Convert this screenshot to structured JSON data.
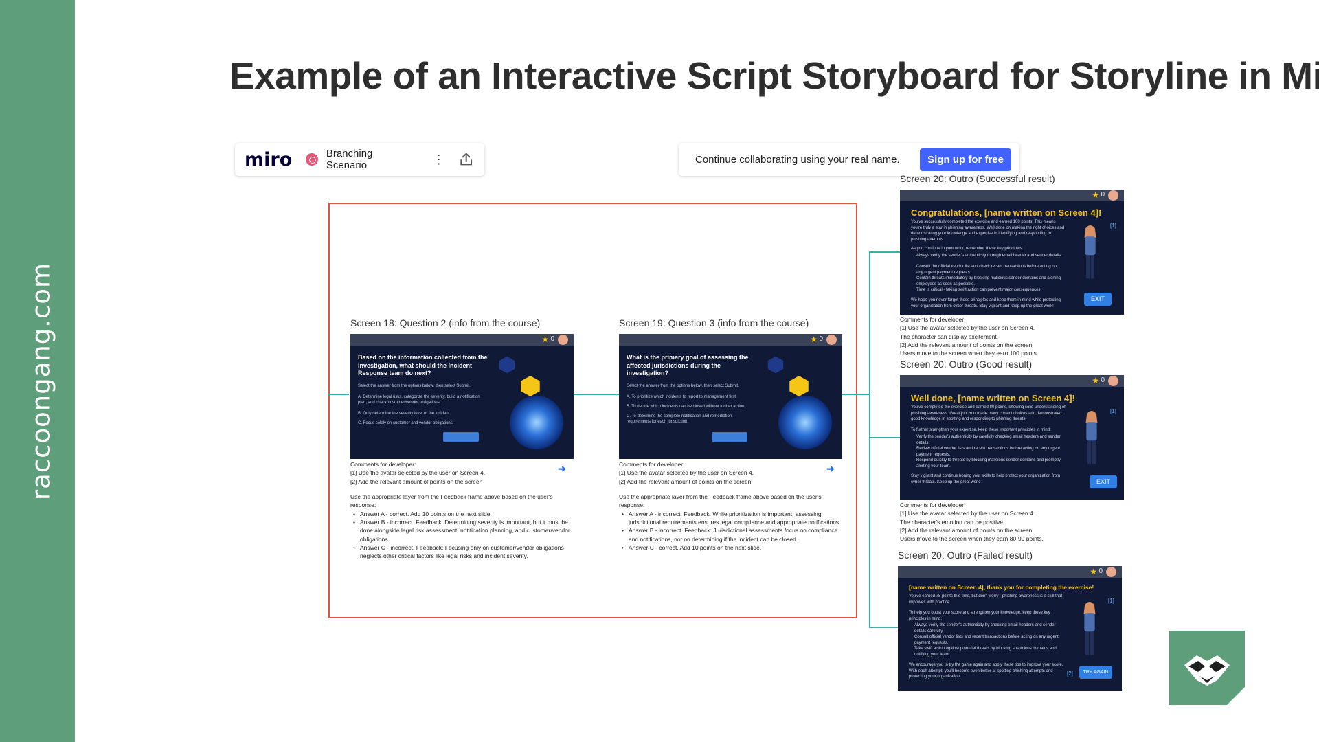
{
  "brand": {
    "vertical_text": "raccoongang.com",
    "band_color": "#5f9e7a"
  },
  "page_title": "Example of an Interactive Script Storyboard for Storyline in Miro",
  "miro_toolbar": {
    "logo": "miro",
    "board_name": "Branching Scenario",
    "menu_icon": "kebab-icon",
    "share_icon": "upload-icon"
  },
  "signup_bar": {
    "text": "Continue collaborating using your real name.",
    "button_label": "Sign up for free",
    "button_color": "#4262ff"
  },
  "screens": {
    "s18": {
      "label": "Screen 18: Question 2 (info from the course)",
      "question": "Based on the information collected from the investigation, what should the Incident Response team do next?",
      "instruction": "Select the answer from the options below, then select Submit.",
      "options": [
        "A. Determine legal risks, categorize the severity, build a notification plan, and check customer/vendor obligations.",
        "B. Only determine the severity level of the incident.",
        "C. Focus solely on customer and vendor obligations."
      ],
      "submit": "Submit",
      "score": "0",
      "comments_heading": "Comments for developer:",
      "comments": [
        "[1] Use the avatar selected by the user on Screen 4.",
        "[2] Add the relevant amount of points on the screen"
      ],
      "layer_note": "Use the appropriate layer from the Feedback frame above based on the user's response:",
      "answers": [
        "Answer A - correct. Add 10 points on the next slide.",
        "Answer B - incorrect. Feedback: Determining severity is important, but it must be done alongside legal risk assessment, notification planning, and customer/vendor obligations.",
        "Answer C - incorrect. Feedback: Focusing only on customer/vendor obligations neglects other critical factors like legal risks and incident severity."
      ]
    },
    "s19": {
      "label": "Screen 19: Question 3 (info from the course)",
      "question": "What is the primary goal of assessing the affected jurisdictions during the investigation?",
      "instruction": "Select the answer from the options below, then select Submit.",
      "options": [
        "A. To prioritize which incidents to report to management first.",
        "B. To decide which incidents can be closed without further action.",
        "C. To determine the complete notification and remediation requirements for each jurisdiction."
      ],
      "submit": "Submit",
      "score": "0",
      "comments_heading": "Comments for developer:",
      "comments": [
        "[1] Use the avatar selected by the user on Screen 4.",
        "[2] Add the relevant amount of points on the screen"
      ],
      "layer_note": "Use the appropriate layer from the Feedback frame above based on the user's response:",
      "answers": [
        "Answer A - incorrect. Feedback: While prioritization is important, assessing jurisdictional requirements ensures legal compliance and appropriate notifications.",
        "Answer B - incorrect. Feedback: Jurisdictional assessments focus on compliance and notifications, not on determining if the incident can be closed.",
        "Answer C - correct. Add 10 points on the next slide."
      ]
    },
    "s20_success": {
      "label": "Screen 20: Outro (Successful result)",
      "title": "Congratulations, [name written on Screen 4]!",
      "body": "You've successfully completed the exercise and earned 100 points! This means you're truly a star in phishing awareness. Well done on making the right choices and demonstrating your knowledge and expertise in identifying and responding to phishing attempts.",
      "principles_intro": "As you continue in your work, remember these key principles:",
      "principles": [
        "Always verify the sender's authenticity through email header and sender details.",
        "Consult the official vendor list and check recent transactions before acting on any urgent payment requests.",
        "Contain threats immediately by blocking malicious sender domains and alerting employees as soon as possible.",
        "Time is critical - taking swift action can prevent major consequences."
      ],
      "closing": "We hope you never forget these principles and keep them in mind while protecting your organization from cyber threats. Stay vigilant and keep up the great work!",
      "button": "EXIT",
      "marker": "[1]",
      "score": "0",
      "comments_heading": "Comments for developer:",
      "comments": [
        "[1] Use the avatar selected by the user on Screen 4.",
        "The character can display excitement.",
        "[2] Add the relevant amount of points on the screen",
        "Users move to the screen when they earn 100 points."
      ]
    },
    "s20_good": {
      "label": "Screen 20: Outro (Good result)",
      "title": "Well done, [name written on Screen 4]!",
      "body": "You've completed the exercise and earned 80 points, showing solid understanding of phishing awareness. Great job! You made many correct choices and demonstrated good knowledge in spotting and responding to phishing threats.",
      "principles_intro": "To further strengthen your expertise, keep these important principles in mind:",
      "principles": [
        "Verify the sender's authenticity by carefully checking email headers and sender details.",
        "Review official vendor lists and recent transactions before acting on any urgent payment requests.",
        "Respond quickly to threats by blocking malicious sender domains and promptly alerting your team."
      ],
      "closing": "Stay vigilant and continue honing your skills to help protect your organization from cyber threats. Keep up the great work!",
      "button": "EXIT",
      "marker": "[1]",
      "score": "0",
      "comments_heading": "Comments for developer:",
      "comments": [
        "[1] Use the avatar selected by the user on Screen 4.",
        "The character's emotion can be positive.",
        "[2] Add the relevant amount of points on the screen",
        "Users move to the screen when they earn 80-99 points."
      ]
    },
    "s20_failed": {
      "label": "Screen 20: Outro (Failed result)",
      "title": "[name written on Screen 4], thank you for completing the exercise!",
      "body": "You've earned 75 points this time, but don't worry - phishing awareness is a skill that improves with practice.",
      "principles_intro": "To help you boost your score and strengthen your knowledge, keep these key principles in mind:",
      "principles": [
        "Always verify the sender's authenticity by checking email headers and sender details carefully.",
        "Consult official vendor lists and recent transactions before acting on any urgent payment requests.",
        "Take swift action against potential threats by blocking suspicious domains and notifying your team."
      ],
      "closing": "We encourage you to try the game again and apply these tips to improve your score. With each attempt, you'll become even better at spotting phishing attempts and protecting your organization.",
      "button": "TRY AGAIN",
      "marker": "[1]",
      "marker2": "[2]",
      "score": "0"
    }
  },
  "colors": {
    "selection_frame": "#e4533f",
    "connector": "#33b3a6",
    "slide_bg": "#101a36",
    "outro_title": "#f5c518",
    "exit_button": "#2f7fe4"
  },
  "logo_icon": "raccoon-mask-icon"
}
